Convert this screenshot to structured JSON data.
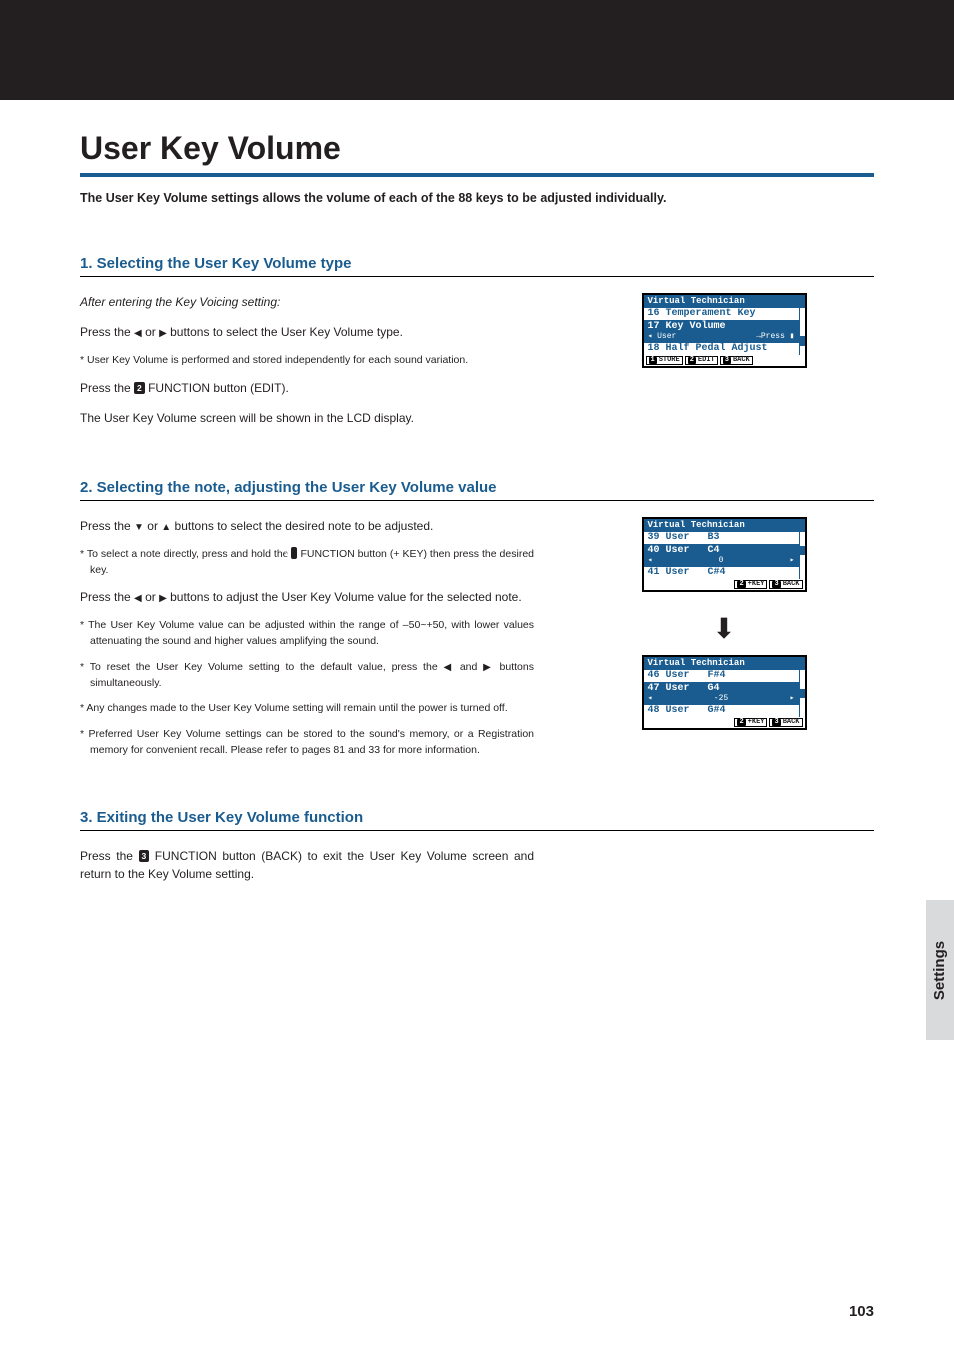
{
  "pageTitle": "User Key Volume",
  "intro": "The User Key Volume settings allows the volume of each of the 88 keys to be adjusted individually.",
  "section1": {
    "title": "1. Selecting the User Key Volume type",
    "p1": "After entering the Key Voicing setting:",
    "p2a": "Press the ",
    "p2b": " or ",
    "p2c": " buttons to select the User Key Volume type.",
    "n1": "* User Key Volume is performed and stored independently for each sound variation.",
    "p3a": "Press the ",
    "p3b": " FUNCTION button (EDIT).",
    "p4": "The User Key Volume screen will be shown in the LCD display."
  },
  "lcd1": {
    "title": "Virtual Technician",
    "r1": "16 Temperament Key",
    "r2": "17 Key Volume",
    "sub_left": "◂ User",
    "sub_right": "→Press ▮",
    "r3": "18 Half Pedal Adjust",
    "btn1": "STORE",
    "btn2": "EDIT",
    "btn3": "BACK"
  },
  "section2": {
    "title": "2. Selecting the note, adjusting the User Key Volume value",
    "p1a": "Press the ",
    "p1b": " or ",
    "p1c": " buttons to select the desired note to be adjusted.",
    "n1a": "* To select a note directly, press and hold the ",
    "n1b": " FUNCTION button (+ KEY) then press the desired key.",
    "p2a": "Press the ",
    "p2b": " or ",
    "p2c": " buttons to adjust the User Key Volume value for the selected note.",
    "n2": "* The User Key Volume value can be adjusted within the range of –50~+50, with lower values attenuating the sound and higher values amplifying the sound.",
    "n3a": "* To reset the User Key Volume setting to the default value, press the ",
    "n3b": " and ",
    "n3c": " buttons simultaneously.",
    "n4": "* Any changes made to the User Key Volume setting will remain until the power is turned off.",
    "n5": "* Preferred User Key Volume settings can be stored to the sound's memory, or a Registration memory for convenient recall.  Please refer to pages 81 and 33 for more information."
  },
  "lcd2": {
    "title": "Virtual Technician",
    "r1": "39 User   B3",
    "r2": "40 User   C4",
    "val": "0",
    "r3": "41 User   C#4",
    "btn2": "+KEY",
    "btn3": "BACK"
  },
  "lcd3": {
    "title": "Virtual Technician",
    "r1": "46 User   F#4",
    "r2": "47 User   G4",
    "val": "-25",
    "r3": "48 User   G#4",
    "btn2": "+KEY",
    "btn3": "BACK"
  },
  "section3": {
    "title": "3. Exiting the User Key Volume function",
    "p1a": "Press the ",
    "p1b": " FUNCTION button (BACK) to exit the User Key Volume screen and return to the Key Volume setting."
  },
  "sideTab": "Settings",
  "pageNum": "103",
  "icons": {
    "num2": "2",
    "num3": "3",
    "num1": "1",
    "left": "◀",
    "right": "▶",
    "down": "▼",
    "up": "▲"
  }
}
